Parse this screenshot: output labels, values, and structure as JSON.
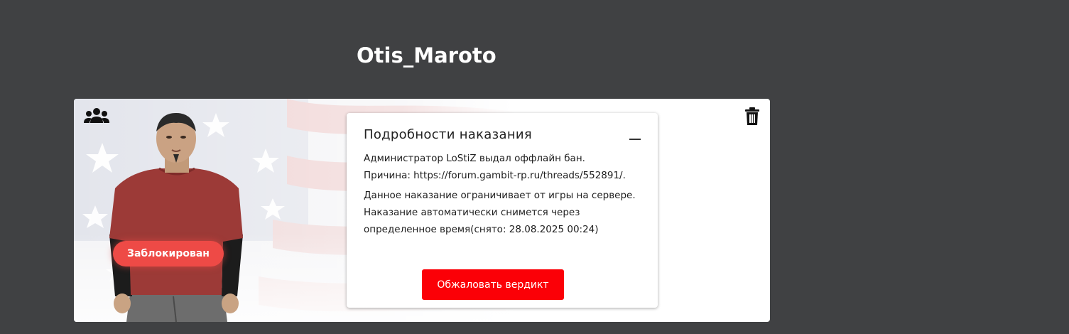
{
  "profile": {
    "username": "Otis_Maroto",
    "status_badge": "Заблокирован"
  },
  "icons": {
    "group": "users-group-icon",
    "delete": "trash-icon",
    "collapse": "minus-icon"
  },
  "punishment": {
    "title": "Подробности наказания",
    "line1": "Администратор LoStiZ выдал оффлайн бан.",
    "line2": "Причина: https://forum.gambit-rp.ru/threads/552891/.",
    "description": "Данное наказание ограничивает от игры на сервере. Наказание автоматически снимется через определенное время(снято: 28.08.2025 00:24)",
    "appeal_label": "Обжаловать вердикт"
  },
  "colors": {
    "background": "#404143",
    "accent_red": "#fb0007",
    "badge_red": "#ee4a46"
  }
}
